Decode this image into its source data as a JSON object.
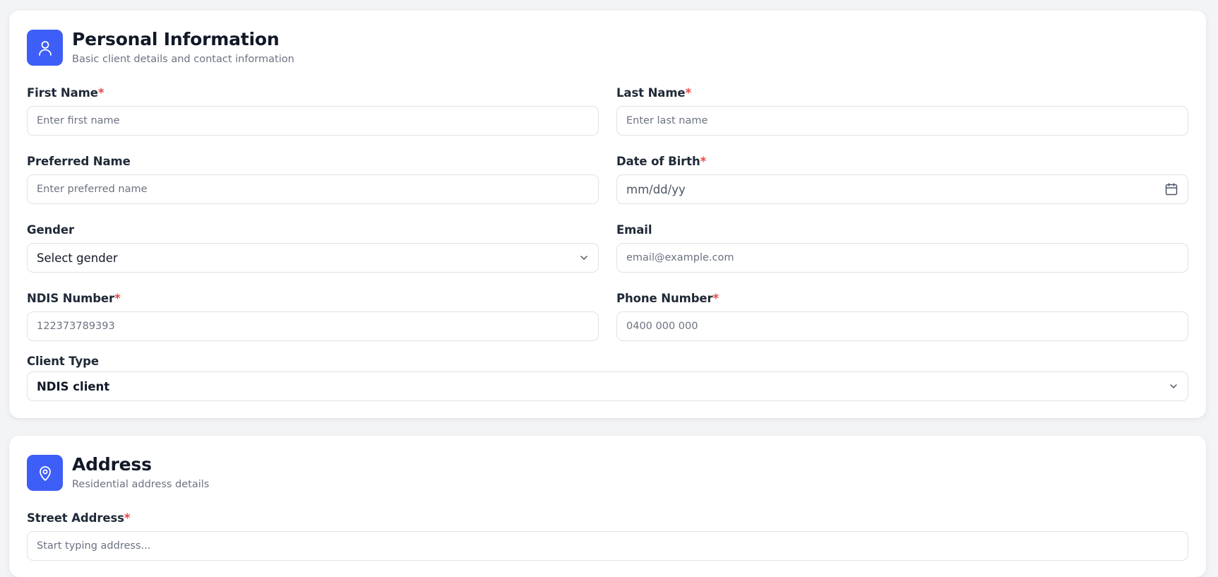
{
  "personal": {
    "title": "Personal Information",
    "subtitle": "Basic client details and contact information",
    "icon": "user-icon",
    "accent": "#3e5ef8",
    "required_mark": "*",
    "fields": {
      "first_name": {
        "label": "First Name",
        "placeholder": "Enter first name"
      },
      "last_name": {
        "label": "Last Name",
        "placeholder": "Enter last name"
      },
      "preferred_name": {
        "label": "Preferred Name",
        "placeholder": "Enter preferred name"
      },
      "dob": {
        "label": "Date of Birth",
        "placeholder": "mm/dd/yy",
        "icon": "calendar-icon"
      },
      "gender": {
        "label": "Gender",
        "value": "Select gender",
        "icon": "chevron-down-icon"
      },
      "email": {
        "label": "Email",
        "placeholder": "email@example.com"
      },
      "ndis": {
        "label": "NDIS Number",
        "value": "122373789393"
      },
      "phone": {
        "label": "Phone Number",
        "placeholder": "0400 000 000"
      },
      "client_type": {
        "label": "Client Type",
        "value": "NDIS client",
        "icon": "chevron-down-icon"
      }
    }
  },
  "address": {
    "title": "Address",
    "subtitle": "Residential address details",
    "icon": "map-pin-icon",
    "fields": {
      "street": {
        "label": "Street Address",
        "placeholder": "Start typing address..."
      }
    }
  }
}
